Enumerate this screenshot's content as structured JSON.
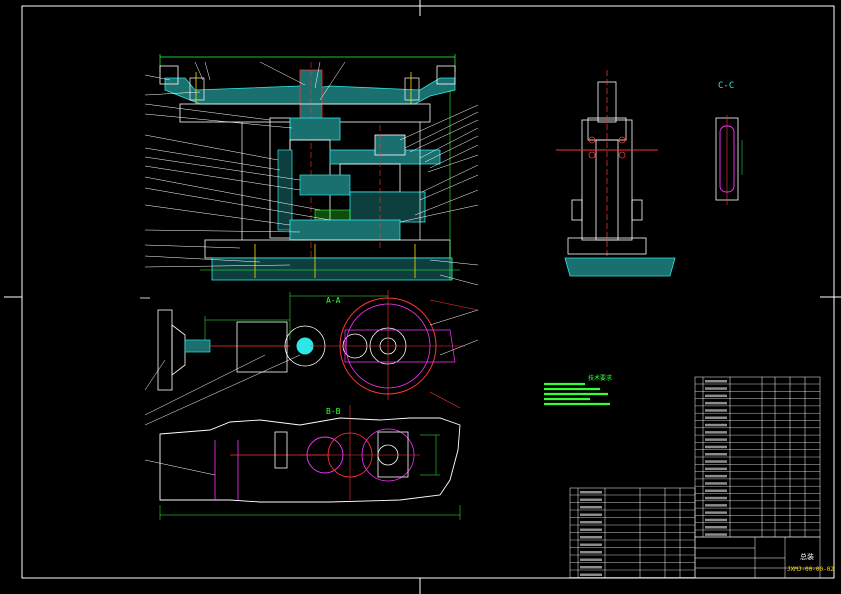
{
  "views": {
    "section_c": "C-C",
    "section_a": "A-A",
    "section_b": "B-B"
  },
  "notes": {
    "heading": "技术要求"
  },
  "title_block": {
    "title": "总装",
    "drawing_no": "JXMJ-00-00-02"
  },
  "colors": {
    "background": "#000000",
    "outline": "#ffffff",
    "dimension": "#33ff33",
    "part": "#2ee6e6",
    "center": "#ff3333",
    "hidden": "#ff33ff",
    "thread": "#ffdd00"
  }
}
